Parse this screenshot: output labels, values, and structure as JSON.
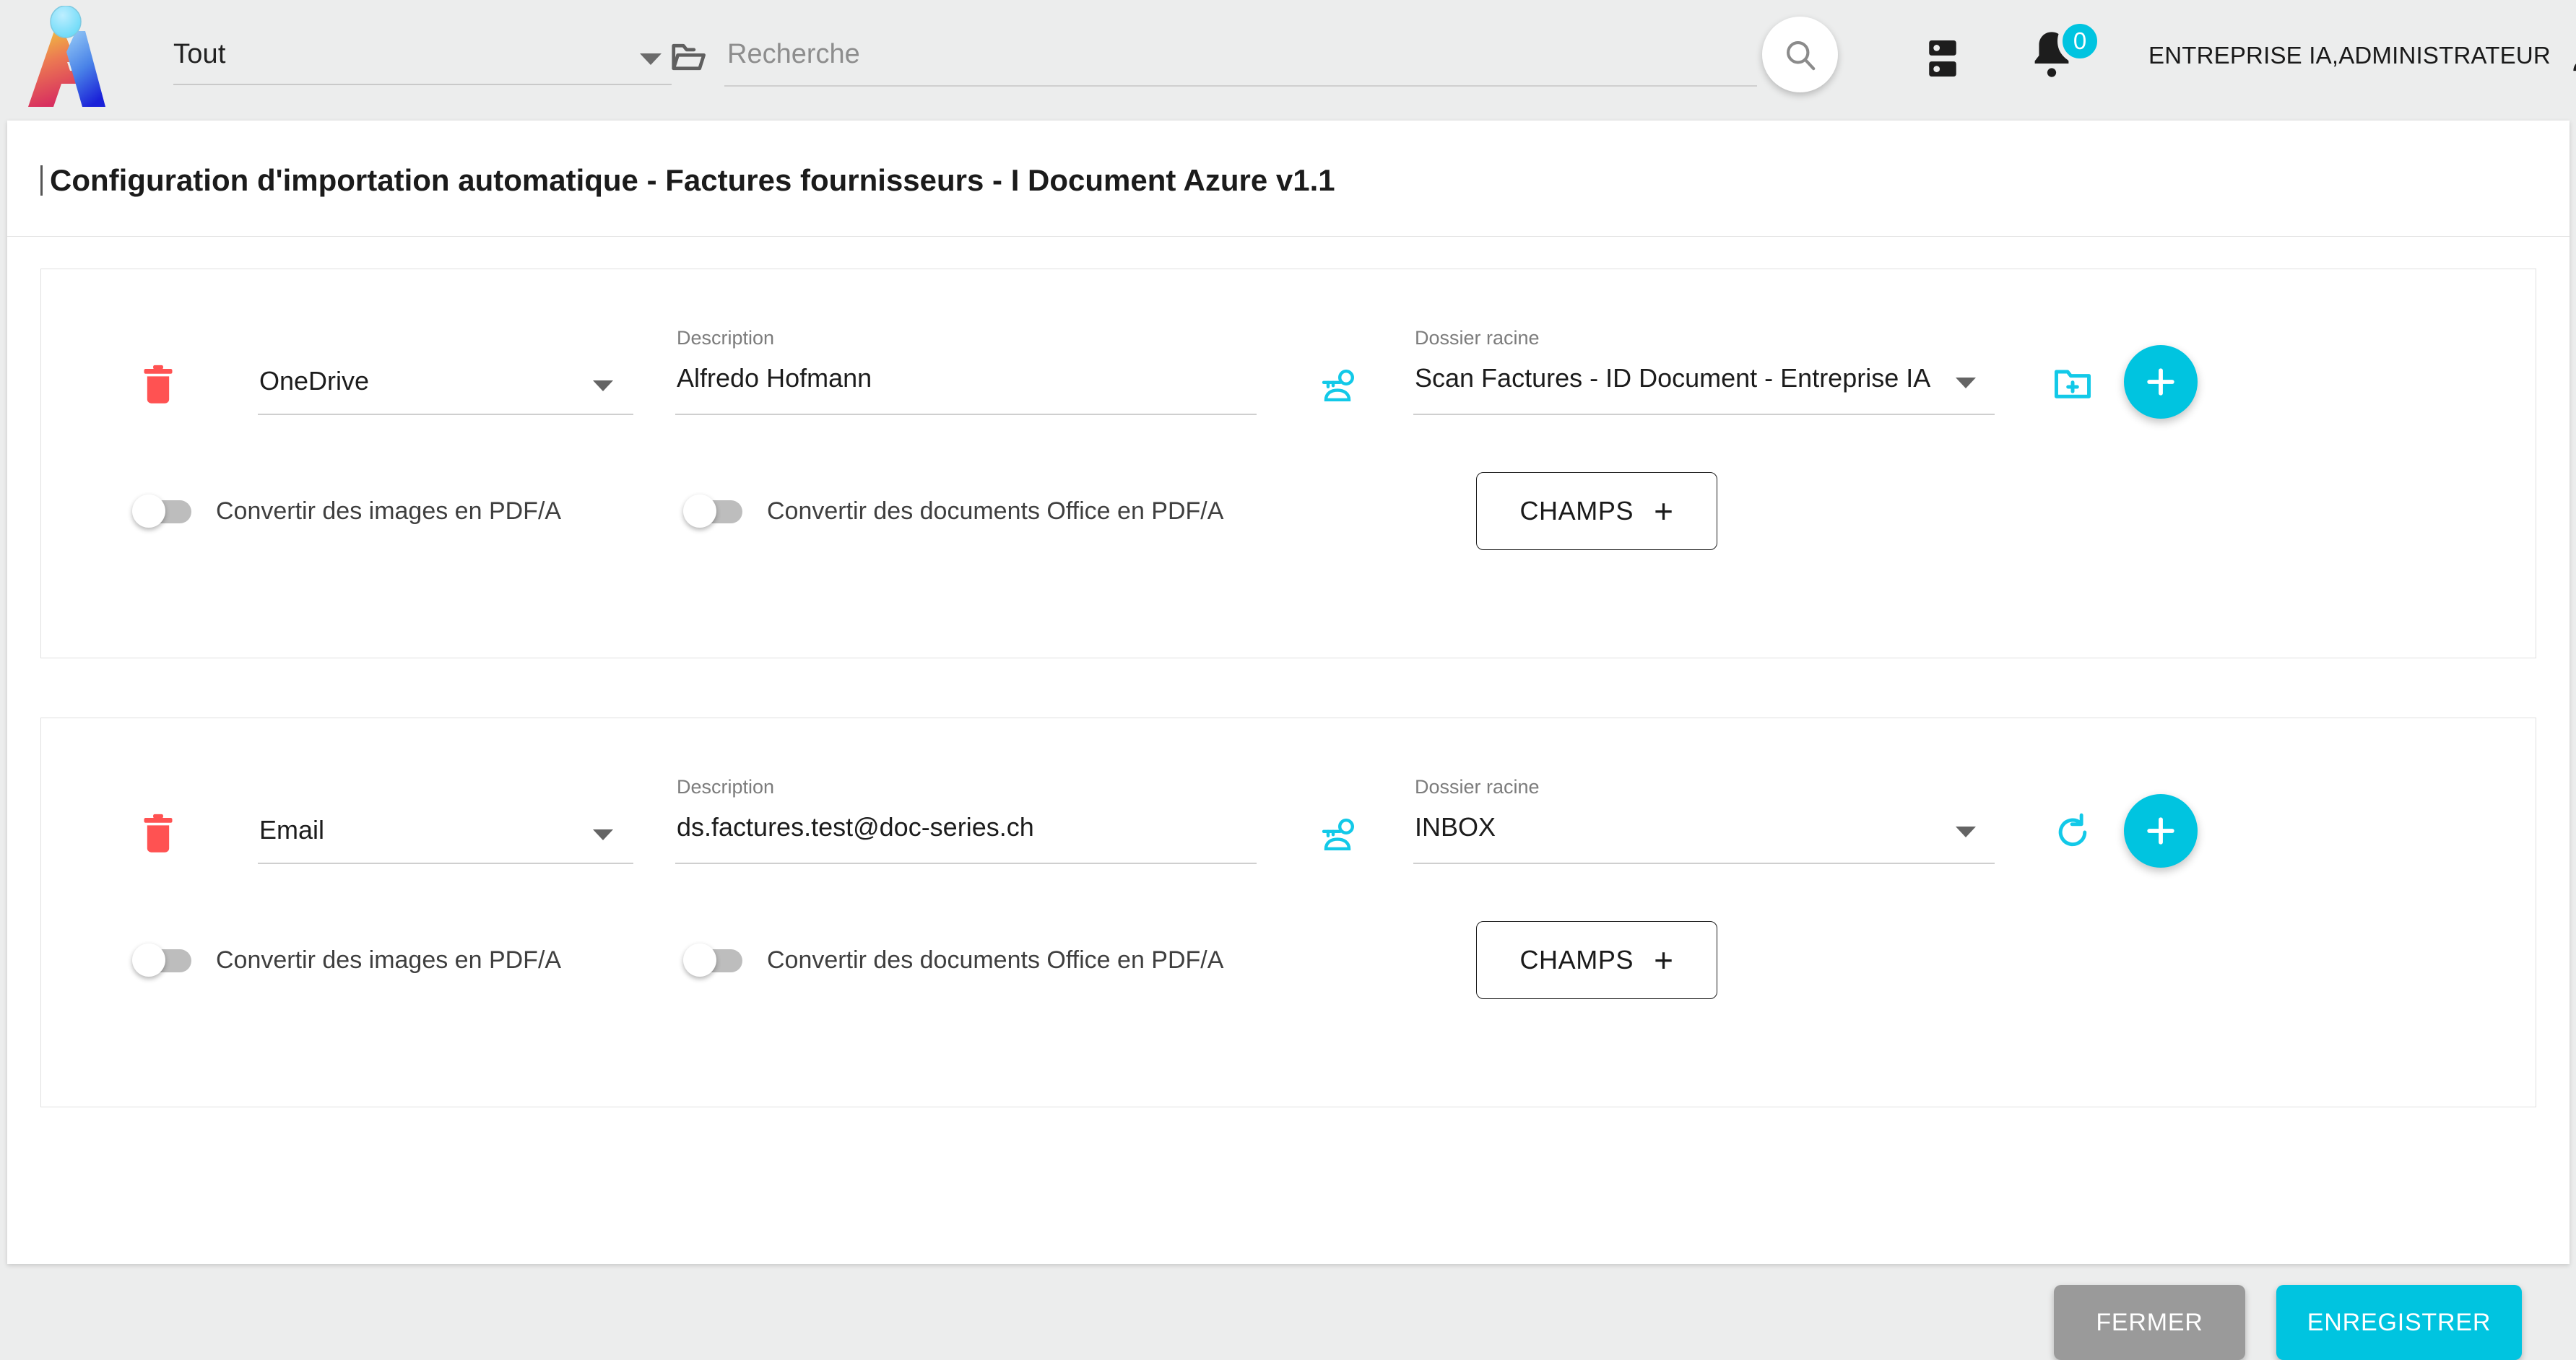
{
  "topbar": {
    "logo_name": "app-logo",
    "scope_select": {
      "value": "Tout",
      "icon": "chevron-down-icon"
    },
    "folder_icon": "folder-open-icon",
    "search": {
      "placeholder": "Recherche",
      "icon": "search-icon"
    },
    "storage_icon": "storage-icon",
    "notifications": {
      "icon": "bell-icon",
      "badge": "0"
    },
    "user": {
      "name": "ENTREPRISE IA,ADMINISTRATEUR",
      "icon": "person-icon"
    }
  },
  "page": {
    "title": "Configuration d'importation automatique - Factures fournisseurs - I Document Azure v1.1"
  },
  "labels": {
    "description": "Description",
    "root_folder": "Dossier racine",
    "convert_images": "Convertir des images en PDF/A",
    "convert_office": "Convertir des documents Office en PDF/A",
    "champs": "CHAMPS",
    "champs_plus": "+"
  },
  "cards": [
    {
      "delete_icon": "trash-icon",
      "source": {
        "value": "OneDrive",
        "caret": "chevron-down-icon"
      },
      "description": {
        "label": "Description",
        "value": "Alfredo Hofmann"
      },
      "key_icon": "account-key-icon",
      "root": {
        "label": "Dossier racine",
        "value": "Scan Factures - ID Document - Entreprise IA",
        "caret": "chevron-down-icon"
      },
      "aux_icon": "folder-add-icon",
      "add_icon": "plus-icon",
      "toggles": [
        {
          "label": "Convertir des images en PDF/A",
          "state": "off"
        },
        {
          "label": "Convertir des documents Office en PDF/A",
          "state": "off"
        }
      ],
      "champs_label": "CHAMPS"
    },
    {
      "delete_icon": "trash-icon",
      "source": {
        "value": "Email",
        "caret": "chevron-down-icon"
      },
      "description": {
        "label": "Description",
        "value": "ds.factures.test@doc-series.ch"
      },
      "key_icon": "account-key-icon",
      "root": {
        "label": "Dossier racine",
        "value": "INBOX",
        "caret": "chevron-down-icon"
      },
      "aux_icon": "refresh-icon",
      "add_icon": "plus-icon",
      "toggles": [
        {
          "label": "Convertir des images en PDF/A",
          "state": "off"
        },
        {
          "label": "Convertir des documents Office en PDF/A",
          "state": "off"
        }
      ],
      "champs_label": "CHAMPS"
    }
  ],
  "footer": {
    "close_label": "FERMER",
    "save_label": "ENREGISTRER"
  },
  "colors": {
    "accent_cyan": "#00c4e0",
    "delete_red": "#ff5252",
    "close_gray": "#9a9a9a",
    "page_bg": "#eceded"
  }
}
